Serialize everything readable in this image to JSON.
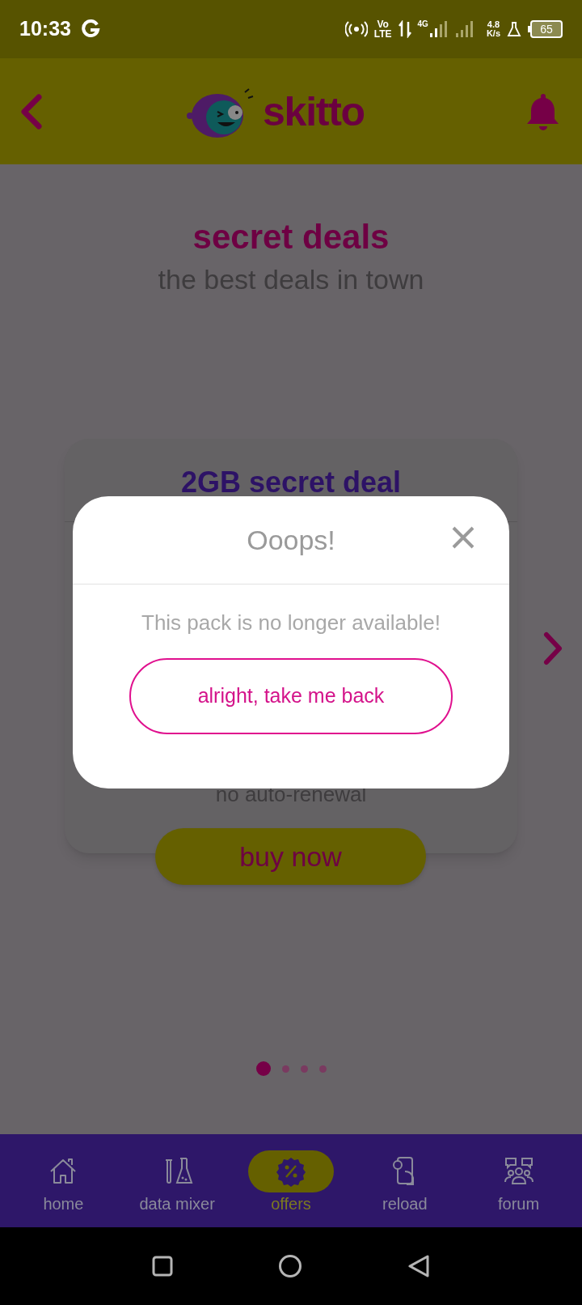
{
  "status_bar": {
    "time": "10:33",
    "volte_top": "Vo",
    "volte_bottom": "LTE",
    "network": "4G",
    "speed_value": "4.8",
    "speed_unit": "K/s",
    "battery": "65"
  },
  "header": {
    "logo_text": "skitto"
  },
  "page": {
    "title": "secret deals",
    "subtitle": "the best deals in town"
  },
  "deal_card": {
    "title": "2GB secret deal",
    "note": "no auto-renewal",
    "button": "buy now"
  },
  "carousel_dots": [
    {
      "selected": true
    },
    {
      "selected": false
    },
    {
      "selected": false
    },
    {
      "selected": false
    }
  ],
  "dialog": {
    "title": "Ooops!",
    "message": "This pack is no longer available!",
    "button": "alright, take me back"
  },
  "bottom_nav": [
    {
      "kind": "home",
      "label": "home",
      "selected": false
    },
    {
      "kind": "mixer",
      "label": "data mixer",
      "selected": false
    },
    {
      "kind": "offers",
      "label": "offers",
      "selected": true
    },
    {
      "kind": "reload",
      "label": "reload",
      "selected": false
    },
    {
      "kind": "forum",
      "label": "forum",
      "selected": false
    }
  ]
}
